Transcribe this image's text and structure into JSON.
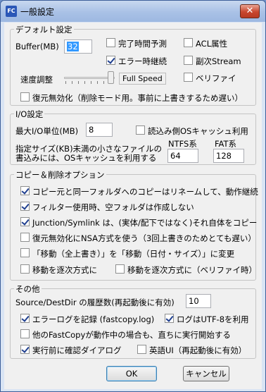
{
  "window": {
    "title": "一般設定",
    "app_icon_text": "FC",
    "close_label": "✕"
  },
  "default_settings": {
    "legend": "デフォルト設定",
    "buffer_label": "Buffer(MB)",
    "buffer_value": "32",
    "speed_label": "速度調整",
    "speed_value": "Full Speed",
    "speed_level": 1.0,
    "checkboxes": {
      "completion_time": {
        "label": "完了時間予測",
        "checked": false
      },
      "error_continue": {
        "label": "エラー時継続",
        "checked": true
      },
      "acl": {
        "label": "ACL属性",
        "checked": false
      },
      "alt_stream": {
        "label": "副次Stream",
        "checked": false
      },
      "verify": {
        "label": "ベリファイ",
        "checked": false
      },
      "restore_disable": {
        "label": "復元無効化（削除モード用。事前に上書きするため遅い）",
        "checked": false
      }
    }
  },
  "io_settings": {
    "legend": "I/O設定",
    "max_io_label": "最大I/O単位(MB)",
    "max_io_value": "8",
    "read_os_cache": {
      "label": "読込み側OSキャッシュ利用",
      "checked": false
    },
    "small_file_line1": "指定サイズ(KB)未満の小さなファイルの",
    "small_file_line2": "書込みには、OSキャッシュを利用する",
    "ntfs_label": "NTFS系",
    "ntfs_value": "64",
    "fat_label": "FAT系",
    "fat_value": "128"
  },
  "copy_delete": {
    "legend": "コピー＆削除オプション",
    "items": [
      {
        "label": "コピー元と同一フォルダへのコピーはリネームして、動作継続",
        "checked": true
      },
      {
        "label": "フィルター使用時、空フォルダは作成しない",
        "checked": true
      },
      {
        "label": "Junction/Symlink は、(実体/配下ではなく)それ自体をコピー",
        "checked": true
      },
      {
        "label": "復元無効化にNSA方式を使う（3回上書きのためとても遅い）",
        "checked": false
      },
      {
        "label": "「移動（全上書き）」を「移動（日付・サイズ）」に変更",
        "checked": false
      }
    ],
    "move_sequential": {
      "label": "移動を逐次方式に",
      "checked": false
    },
    "move_sequential_verify": {
      "label": "移動を逐次方式に（ベリファイ時）",
      "checked": false
    }
  },
  "other": {
    "legend": "その他",
    "history_label": "Source/DestDir の履歴数(再起動後に有効)",
    "history_value": "10",
    "error_log": {
      "label": "エラーログを記録 (fastcopy.log)",
      "checked": true
    },
    "log_utf8": {
      "label": "ログはUTF-8を利用",
      "checked": true
    },
    "immediate_start": {
      "label": "他のFastCopyが動作中の場合も、直ちに実行開始する",
      "checked": false
    },
    "confirm_dialog": {
      "label": "実行前に確認ダイアログ",
      "checked": true
    },
    "english_ui": {
      "label": "英語UI（再起動後に有効）",
      "checked": false
    }
  },
  "buttons": {
    "ok": "OK",
    "cancel": "キャンセル"
  }
}
